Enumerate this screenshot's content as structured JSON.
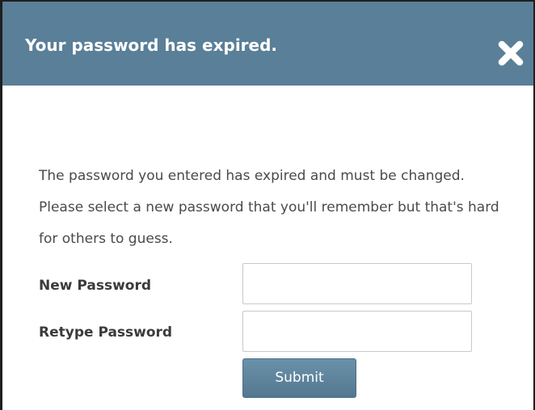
{
  "dialog": {
    "title": "Your password has expired.",
    "close_icon": "close-x-icon",
    "header_color": "#5a7f98",
    "message": "The password you entered has expired and must be changed. Please select a new password that you'll remember but that's hard for others to guess."
  },
  "form": {
    "new_password_label": "New Password",
    "new_password_value": "",
    "retype_password_label": "Retype Password",
    "retype_password_value": "",
    "submit_label": "Submit"
  }
}
